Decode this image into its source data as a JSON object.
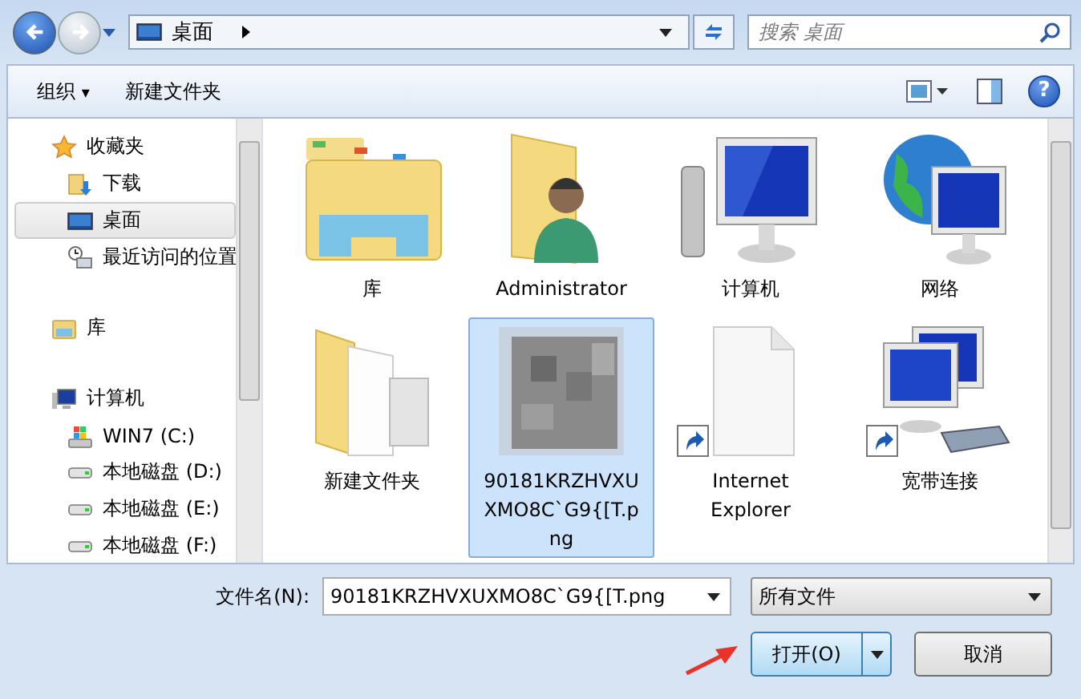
{
  "address": {
    "location": "桌面"
  },
  "search": {
    "placeholder": "搜索 桌面"
  },
  "toolbar": {
    "organize": "组织",
    "organize_caret": "▾",
    "new_folder": "新建文件夹",
    "help": "?"
  },
  "sidebar": {
    "groups": [
      {
        "label": "收藏夹",
        "kind": "star",
        "selected": false,
        "children": [
          {
            "label": "下载",
            "kind": "download",
            "selected": false
          },
          {
            "label": "桌面",
            "kind": "desktop",
            "selected": true
          },
          {
            "label": "最近访问的位置",
            "kind": "recent",
            "selected": false
          }
        ]
      },
      {
        "label": "库",
        "kind": "library",
        "selected": false
      },
      {
        "label": "计算机",
        "kind": "computer",
        "selected": false,
        "children": [
          {
            "label": "WIN7 (C:)",
            "kind": "system-drive",
            "selected": false
          },
          {
            "label": "本地磁盘 (D:)",
            "kind": "drive",
            "selected": false
          },
          {
            "label": "本地磁盘 (E:)",
            "kind": "drive",
            "selected": false
          },
          {
            "label": "本地磁盘 (F:)",
            "kind": "drive",
            "selected": false
          }
        ]
      }
    ]
  },
  "items": [
    {
      "name": "库",
      "kind": "library",
      "shortcut": false,
      "selected": false
    },
    {
      "name": "Administrator",
      "kind": "user-folder",
      "shortcut": false,
      "selected": false
    },
    {
      "name": "计算机",
      "kind": "computer",
      "shortcut": false,
      "selected": false
    },
    {
      "name": "网络",
      "kind": "network",
      "shortcut": false,
      "selected": false
    },
    {
      "name": "新建文件夹",
      "kind": "folder",
      "shortcut": false,
      "selected": false
    },
    {
      "name": "90181KRZHVXUXMO8C`G9{[T.png",
      "kind": "image",
      "shortcut": false,
      "selected": true
    },
    {
      "name": "Internet Explorer",
      "kind": "file",
      "shortcut": true,
      "selected": false
    },
    {
      "name": "宽带连接",
      "kind": "connection",
      "shortcut": true,
      "selected": false
    }
  ],
  "filename": {
    "label": "文件名(N):",
    "value": "90181KRZHVXUXMO8C`G9{[T.png"
  },
  "filetype": {
    "value": "所有文件"
  },
  "buttons": {
    "open": "打开(O)",
    "cancel": "取消"
  }
}
